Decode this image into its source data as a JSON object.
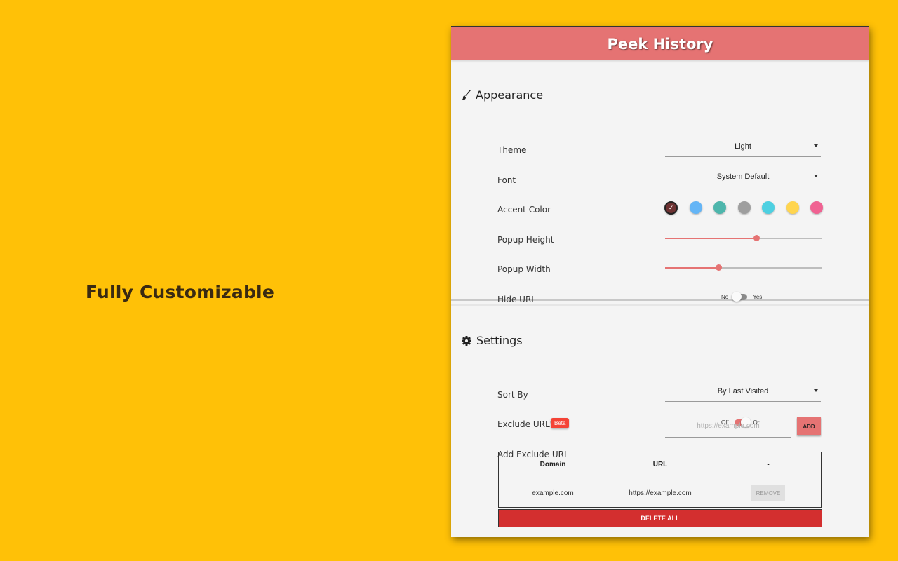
{
  "tagline": "Fully Customizable",
  "app": {
    "title": "Peek History",
    "accent": "#e57373"
  },
  "appearance": {
    "heading": "Appearance",
    "icon": "paintbrush-icon",
    "theme": {
      "label": "Theme",
      "value": "Light"
    },
    "font": {
      "label": "Font",
      "value": "System Default"
    },
    "accent_color": {
      "label": "Accent Color",
      "colors": [
        "#6d3232",
        "#64b5f6",
        "#4db6ac",
        "#9e9e9e",
        "#4dd0e1",
        "#ffd54f",
        "#f06292"
      ],
      "selected_index": 0
    },
    "popup_height": {
      "label": "Popup Height",
      "value_fraction": 0.58
    },
    "popup_width": {
      "label": "Popup Width",
      "value_fraction": 0.34
    },
    "hide_url": {
      "label": "Hide URL",
      "off_label": "No",
      "on_label": "Yes",
      "on": false
    }
  },
  "settings": {
    "heading": "Settings",
    "icon": "gear-icon",
    "sort_by": {
      "label": "Sort By",
      "value": "By Last Visited"
    },
    "exclude_urls": {
      "label": "Exclude URL's",
      "badge": "Beta",
      "off_label": "Off",
      "on_label": "On",
      "on": true
    },
    "add_exclude": {
      "label": "Add Exclude URL",
      "placeholder": "https://example.com",
      "button": "ADD"
    },
    "table": {
      "headers": [
        "Domain",
        "URL",
        "-"
      ],
      "rows": [
        {
          "domain": "example.com",
          "url": "https://example.com",
          "action": "REMOVE"
        }
      ]
    },
    "delete_all": "DELETE ALL"
  }
}
